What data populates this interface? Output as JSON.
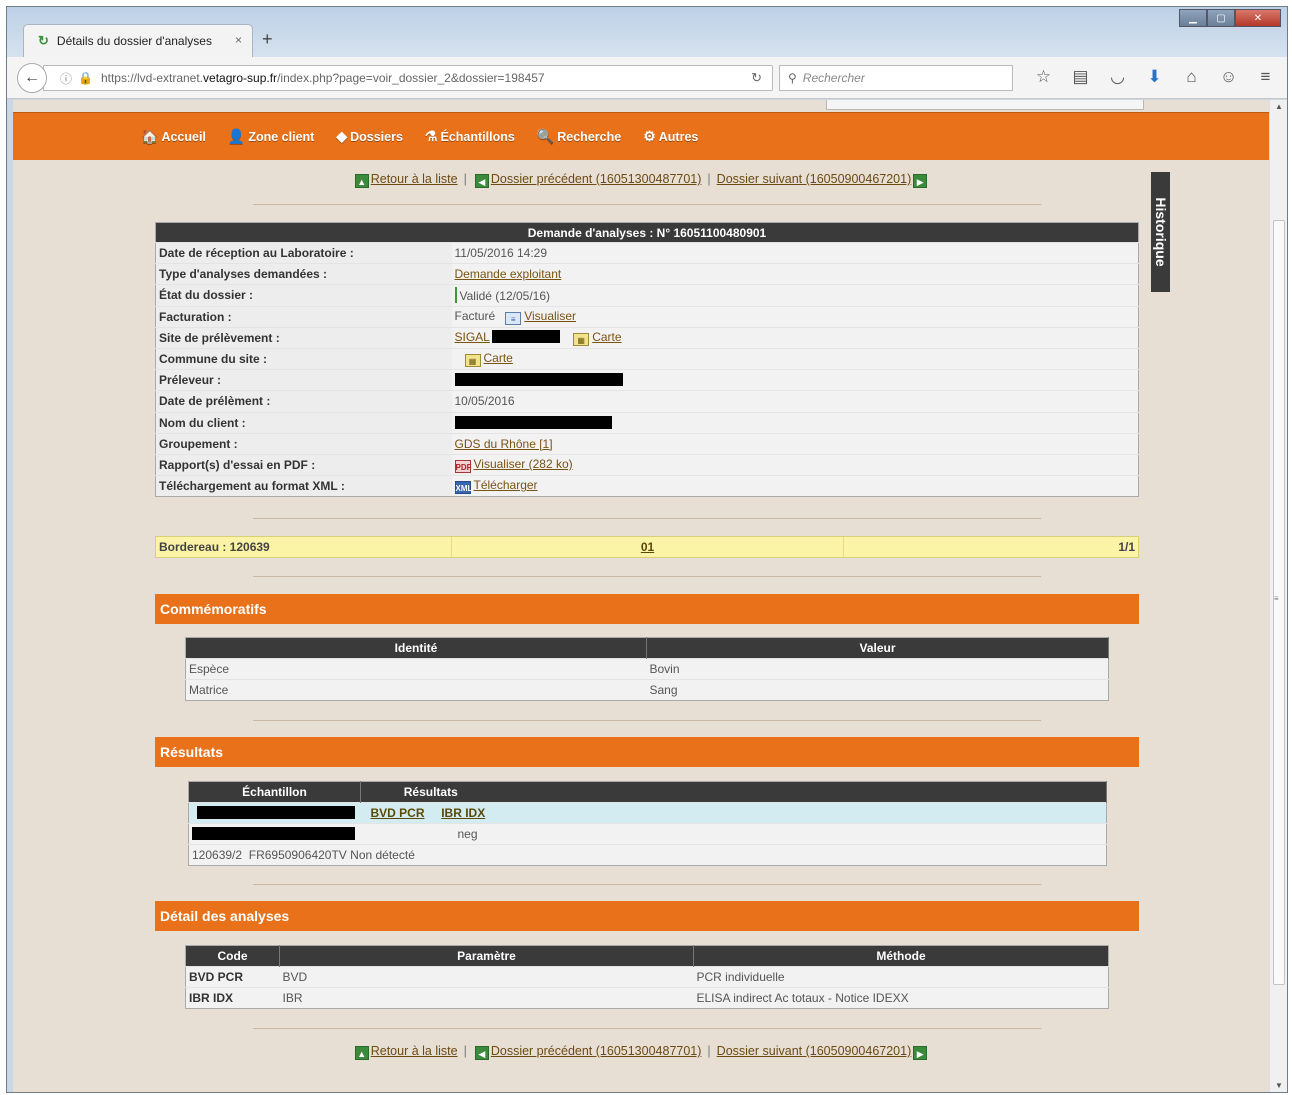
{
  "browser": {
    "tab_title": "Détails du dossier d'analyses",
    "tab_close": "×",
    "new_tab": "+",
    "url_prefix": "https://lvd-extranet.",
    "url_domain": "vetagro-sup.fr",
    "url_rest": "/index.php?page=voir_dossier_2&dossier=198457",
    "search_placeholder": "Rechercher"
  },
  "menu": {
    "items": [
      {
        "label": "Accueil",
        "icon": "home-icon"
      },
      {
        "label": "Zone client",
        "icon": "client-icon"
      },
      {
        "label": "Dossiers",
        "icon": "folder-icon"
      },
      {
        "label": "Échantillons",
        "icon": "samples-icon"
      },
      {
        "label": "Recherche",
        "icon": "search-icon"
      },
      {
        "label": "Autres",
        "icon": "others-icon"
      }
    ]
  },
  "nav": {
    "back_to_list": "Retour à la liste",
    "sep": "|",
    "previous": "Dossier précédent (16051300487701)",
    "next": "Dossier suivant (16050900467201)"
  },
  "historique": "Historique",
  "demande": {
    "title": "Demande d'analyses : N° 16051100480901",
    "rows": {
      "reception": {
        "label": "Date de réception au Laboratoire :",
        "value": "11/05/2016 14:29"
      },
      "type": {
        "label": "Type d'analyses demandées :",
        "value": "Demande exploitant"
      },
      "etat": {
        "label": "État du dossier :",
        "value": "Validé (12/05/16)"
      },
      "facturation": {
        "label": "Facturation :",
        "value": "Facturé",
        "link": "Visualiser"
      },
      "site": {
        "label": "Site de prélèvement :",
        "value": "SIGAL",
        "link": "Carte"
      },
      "commune": {
        "label": "Commune du site :",
        "link": "Carte"
      },
      "preleveur": {
        "label": "Préleveur :"
      },
      "date_prel": {
        "label": "Date de prélèment :",
        "value": "10/05/2016"
      },
      "client": {
        "label": "Nom du client :"
      },
      "groupement": {
        "label": "Groupement :",
        "value": "GDS du Rhône [1]"
      },
      "rapport": {
        "label": "Rapport(s) d'essai en PDF :",
        "value": "Visualiser (282 ko)"
      },
      "xml": {
        "label": "Téléchargement au format XML :",
        "value": "Télécharger"
      }
    }
  },
  "bordereau": {
    "label": "Bordereau : 120639",
    "page": "01",
    "count": "1/1"
  },
  "commemoratifs": {
    "title": "Commémoratifs",
    "headers": [
      "Identité",
      "Valeur"
    ],
    "rows": [
      {
        "identite": "Espèce",
        "valeur": "Bovin"
      },
      {
        "identite": "Matrice",
        "valeur": "Sang"
      }
    ]
  },
  "resultats": {
    "title": "Résultats",
    "headers": [
      "Échantillon",
      "Résultats"
    ],
    "link1": "BVD PCR",
    "link2": "IBR IDX",
    "neg": "neg",
    "sample_id": "120639/2",
    "sample_ref": "FR6950906420TV",
    "sample_result": "Non détecté"
  },
  "detail": {
    "title": "Détail des analyses",
    "headers": [
      "Code",
      "Paramètre",
      "Méthode"
    ],
    "rows": [
      {
        "code": "BVD PCR",
        "param": "BVD",
        "methode": "PCR individuelle"
      },
      {
        "code": "IBR IDX",
        "param": "IBR",
        "methode": "ELISA indirect Ac totaux - Notice IDEXX"
      }
    ]
  },
  "colors": {
    "orange": "#e8711a",
    "dark_header": "#3a3a3a",
    "page_bg": "#e8dfd4",
    "bordereau_bg": "#fbf3a5"
  }
}
